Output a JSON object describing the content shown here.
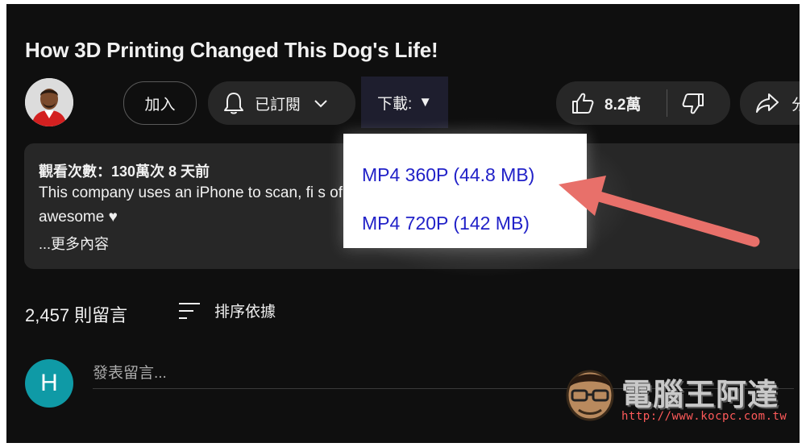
{
  "video": {
    "title": "How 3D Printing Changed This Dog's Life!"
  },
  "channel": {
    "join_label": "加入",
    "subscribed_label": "已訂閱",
    "download_label": "下載:",
    "download_toggle": "▼"
  },
  "actions": {
    "like_count": "8.2萬",
    "share_label": "分"
  },
  "description": {
    "views": "觀看次數：130萬次  8 天前",
    "body_line1": "This company uses an iPhone to scan, fi                                                       s of all shapes and sizes, ar",
    "body_line2": "awesome ♥",
    "more_label": "...更多內容"
  },
  "download_menu": {
    "options": [
      {
        "label": "MP4 360P (44.8 MB)"
      },
      {
        "label": "MP4 720P (142 MB)"
      }
    ]
  },
  "comments": {
    "count_label": "2,457 則留言",
    "sort_label": "排序依據",
    "user_initial": "H",
    "placeholder": "發表留言..."
  },
  "watermark": {
    "text": "電腦王阿達",
    "url": "http://www.kocpc.com.tw"
  },
  "colors": {
    "background": "#0f0f0f",
    "surface": "#272727",
    "menu_link": "#2121c8",
    "annotation_arrow": "#e8706a",
    "comment_avatar": "#0f9aa6"
  }
}
